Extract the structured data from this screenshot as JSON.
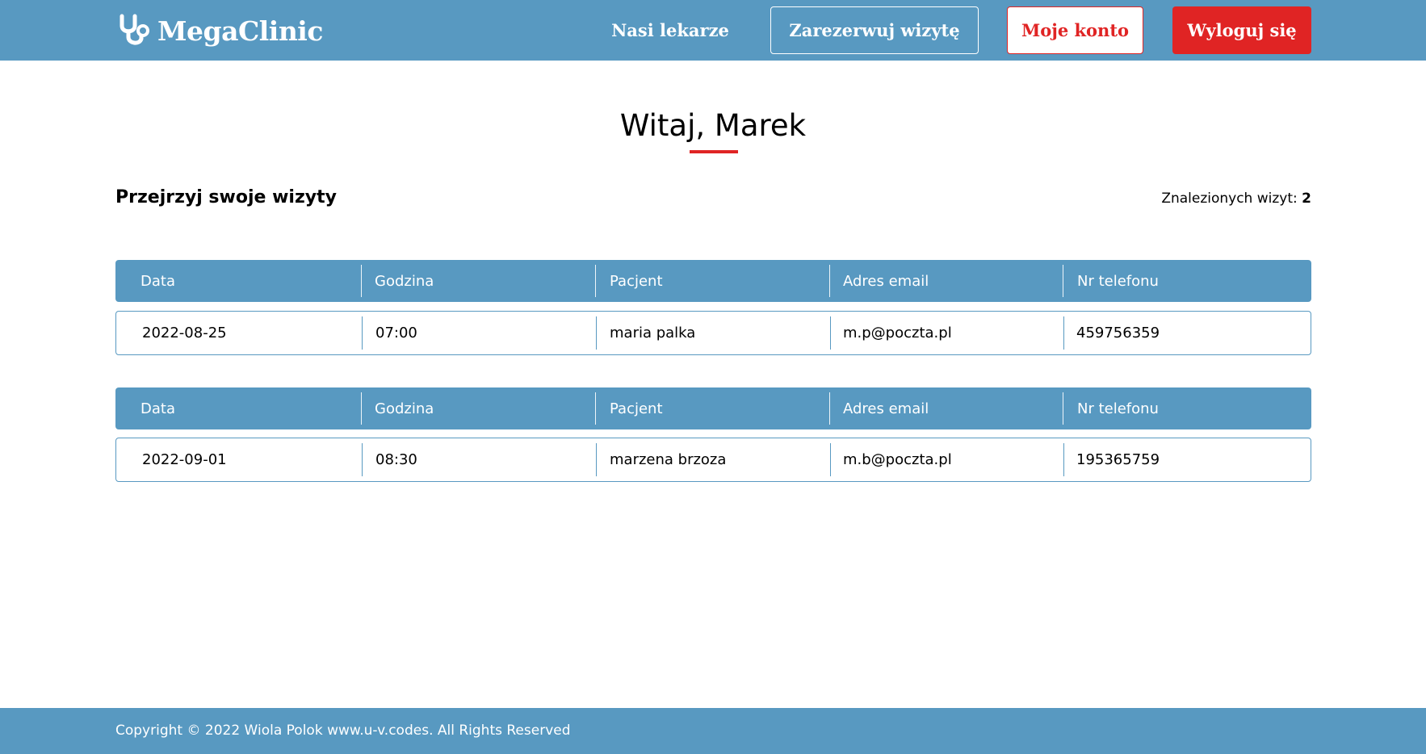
{
  "brand": {
    "name": "MegaClinic",
    "icon": "stethoscope-icon"
  },
  "nav": {
    "doctors": "Nasi lekarze",
    "book": "Zarezerwuj wizytę",
    "account": "Moje konto",
    "logout": "Wyloguj się"
  },
  "greeting": "Witaj, Marek",
  "section_title": "Przejrzyj swoje wizyty",
  "found": {
    "label": "Znalezionych wizyt:",
    "count": "2"
  },
  "columns": [
    "Data",
    "Godzina",
    "Pacjent",
    "Adres email",
    "Nr telefonu"
  ],
  "visits": [
    {
      "date": "2022-08-25",
      "time": "07:00",
      "patient": "maria palka",
      "email": "m.p@poczta.pl",
      "phone": "459756359"
    },
    {
      "date": "2022-09-01",
      "time": "08:30",
      "patient": "marzena brzoza",
      "email": "m.b@poczta.pl",
      "phone": "195365759"
    }
  ],
  "footer": "Copyright © 2022 Wiola Polok www.u-v.codes. All Rights Reserved",
  "colors": {
    "primary": "#5899c1",
    "accent": "#e02424",
    "white": "#ffffff"
  }
}
